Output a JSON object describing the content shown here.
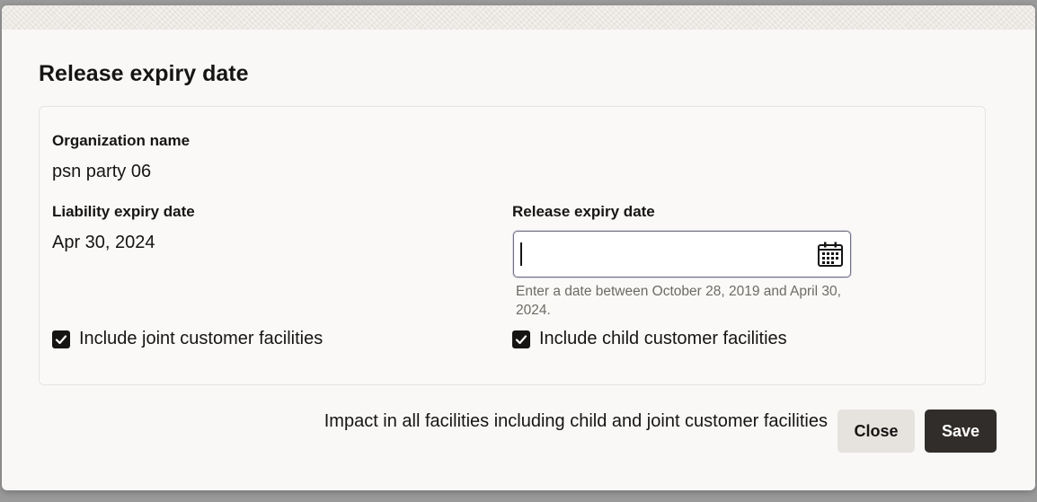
{
  "dialog": {
    "title": "Release expiry date"
  },
  "form": {
    "organization": {
      "label": "Organization name",
      "value": "psn party 06"
    },
    "liability_expiry": {
      "label": "Liability expiry date",
      "value": "Apr 30, 2024"
    },
    "release_expiry": {
      "label": "Release expiry date",
      "value": "",
      "placeholder": "",
      "hint": "Enter a date between October 28, 2019 and April 30, 2024."
    },
    "include_joint": {
      "label": "Include joint customer facilities",
      "checked": true
    },
    "include_child": {
      "label": "Include child customer facilities",
      "checked": true
    }
  },
  "footer": {
    "impact_text": "Impact in all facilities including child and joint customer facilities",
    "close_label": "Close",
    "save_label": "Save"
  },
  "icons": {
    "calendar": "calendar-icon",
    "checkmark": "checkmark-icon"
  },
  "colors": {
    "primary_button": "#312d2a",
    "secondary_button": "#e6e3df",
    "text": "#161513",
    "hint_text": "#6e6b66",
    "input_border": "#6f6f83"
  }
}
